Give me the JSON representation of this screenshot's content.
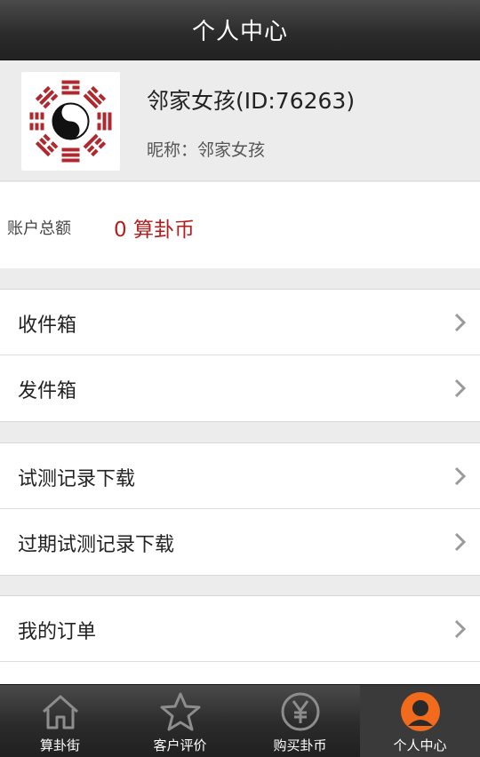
{
  "header": {
    "title": "个人中心"
  },
  "profile": {
    "name": "邻家女孩(ID:76263)",
    "nickname": "昵称：邻家女孩",
    "avatar_icon": "bagua-icon"
  },
  "account": {
    "label": "账户总额",
    "amount": "0 算卦币",
    "amount_color": "#b21e1e"
  },
  "menu": {
    "inbox": "收件箱",
    "outbox": "发件箱",
    "test_download": "试测记录下载",
    "expired_download": "过期试测记录下载",
    "orders": "我的订单"
  },
  "tabs": [
    {
      "label": "算卦街",
      "icon": "home-icon"
    },
    {
      "label": "客户评价",
      "icon": "star-icon"
    },
    {
      "label": "购买卦币",
      "icon": "yen-coin-icon"
    },
    {
      "label": "个人中心",
      "icon": "user-icon",
      "active": true,
      "accent": "#f26b1d"
    }
  ]
}
